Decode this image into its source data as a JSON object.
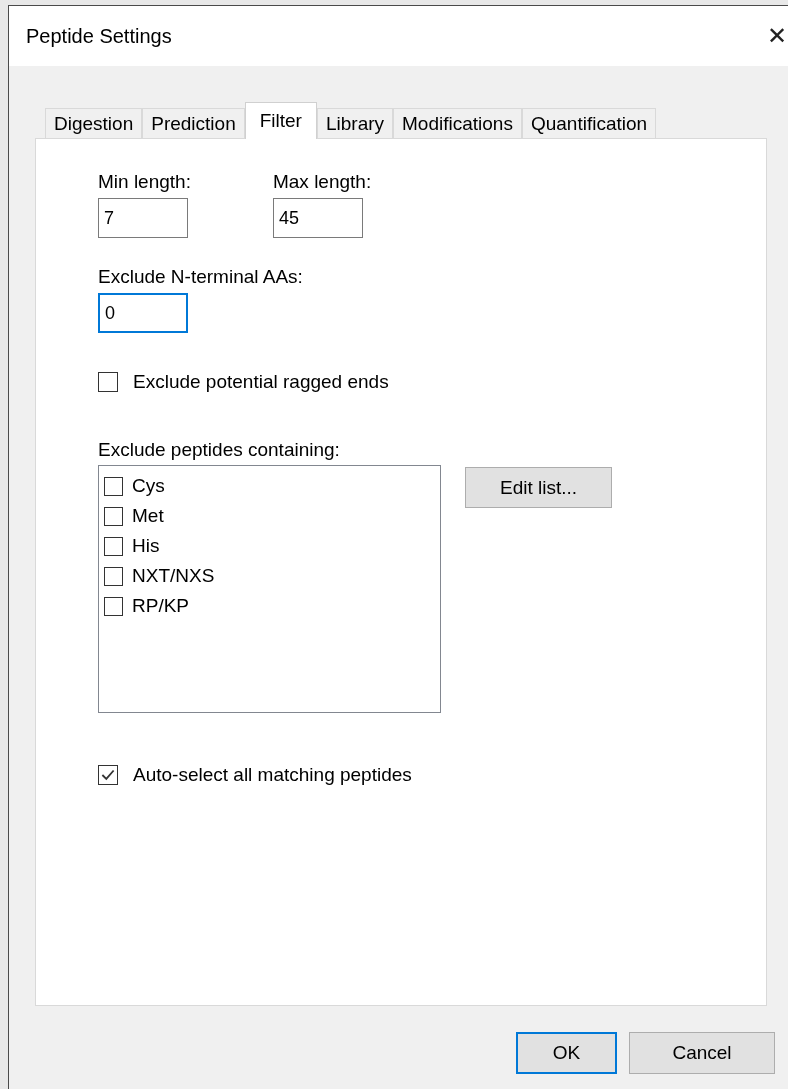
{
  "window": {
    "title": "Peptide Settings",
    "close": "✕"
  },
  "tabs": [
    {
      "label": "Digestion",
      "selected": false
    },
    {
      "label": "Prediction",
      "selected": false
    },
    {
      "label": "Filter",
      "selected": true
    },
    {
      "label": "Library",
      "selected": false
    },
    {
      "label": "Modifications",
      "selected": false
    },
    {
      "label": "Quantification",
      "selected": false
    }
  ],
  "length_fields": [
    {
      "label": "Min length:",
      "value": "7",
      "focused": false
    },
    {
      "label": "Max length:",
      "value": "45",
      "focused": false
    }
  ],
  "exclude_n_terminal": {
    "label": "Exclude N-terminal AAs:",
    "value": "0",
    "focused": true
  },
  "ragged_ends": {
    "label": "Exclude potential ragged ends",
    "checked": false
  },
  "exclude_list": {
    "label": "Exclude peptides containing:",
    "items": [
      {
        "label": "Cys",
        "checked": false
      },
      {
        "label": "Met",
        "checked": false
      },
      {
        "label": "His",
        "checked": false
      },
      {
        "label": "NXT/NXS",
        "checked": false
      },
      {
        "label": "RP/KP",
        "checked": false
      }
    ],
    "edit_button": "Edit list..."
  },
  "auto_select": {
    "label": "Auto-select all matching peptides",
    "checked": true
  },
  "buttons": [
    {
      "label": "OK",
      "default": true
    },
    {
      "label": "Cancel",
      "default": false
    }
  ]
}
